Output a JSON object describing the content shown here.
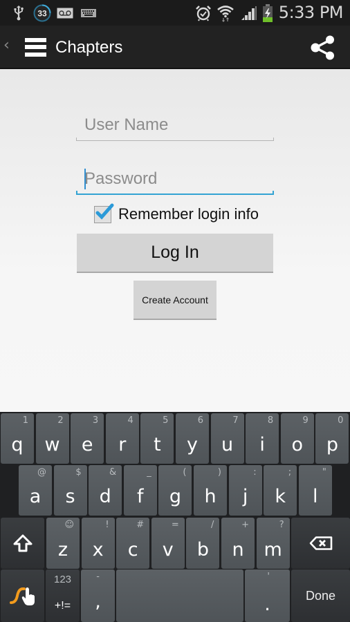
{
  "status_bar": {
    "icons_left": [
      "usb-icon",
      "notification-count-badge",
      "voicemail-icon",
      "keyboard-icon"
    ],
    "notification_count": "33",
    "icons_right": [
      "alarm-icon",
      "wifi-icon",
      "signal-icon",
      "battery-charging-icon"
    ],
    "time": "5:33 PM"
  },
  "action_bar": {
    "title": "Chapters",
    "back_glyph": "‹",
    "menu_icon": "hamburger-menu-icon",
    "share_icon": "share-icon"
  },
  "login_form": {
    "username": {
      "value": "",
      "placeholder": "User Name"
    },
    "password": {
      "value": "",
      "placeholder": "Password",
      "focused": true
    },
    "remember": {
      "label": "Remember login info",
      "checked": true
    },
    "login_button": "Log In",
    "create_account_button": "Create Account"
  },
  "colors": {
    "accent": "#33a3d3",
    "checkbox_check": "#2b9ad8",
    "swype_orange": "#f29b1d"
  },
  "keyboard": {
    "row1": [
      {
        "key": "q",
        "hint": "1"
      },
      {
        "key": "w",
        "hint": "2"
      },
      {
        "key": "e",
        "hint": "3"
      },
      {
        "key": "r",
        "hint": "4"
      },
      {
        "key": "t",
        "hint": "5"
      },
      {
        "key": "y",
        "hint": "6"
      },
      {
        "key": "u",
        "hint": "7"
      },
      {
        "key": "i",
        "hint": "8"
      },
      {
        "key": "o",
        "hint": "9"
      },
      {
        "key": "p",
        "hint": "0"
      }
    ],
    "row2": [
      {
        "key": "a",
        "hint": "@"
      },
      {
        "key": "s",
        "hint": "$"
      },
      {
        "key": "d",
        "hint": "&"
      },
      {
        "key": "f",
        "hint": "_"
      },
      {
        "key": "g",
        "hint": "("
      },
      {
        "key": "h",
        "hint": ")"
      },
      {
        "key": "j",
        "hint": ":"
      },
      {
        "key": "k",
        "hint": ";"
      },
      {
        "key": "l",
        "hint": "\""
      }
    ],
    "row3": [
      {
        "key": "z",
        "hint": "☺"
      },
      {
        "key": "x",
        "hint": "!"
      },
      {
        "key": "c",
        "hint": "#"
      },
      {
        "key": "v",
        "hint": "="
      },
      {
        "key": "b",
        "hint": "/"
      },
      {
        "key": "n",
        "hint": "+"
      },
      {
        "key": "m",
        "hint": "?"
      }
    ],
    "shift_icon": "shift-icon",
    "backspace_icon": "backspace-icon",
    "swype_icon": "swype-icon",
    "symbols_top": "123",
    "symbols_bottom": "+!=",
    "comma": {
      "key": ",",
      "hint": "-"
    },
    "period": {
      "key": ".",
      "hint": "'"
    },
    "done_label": "Done"
  }
}
